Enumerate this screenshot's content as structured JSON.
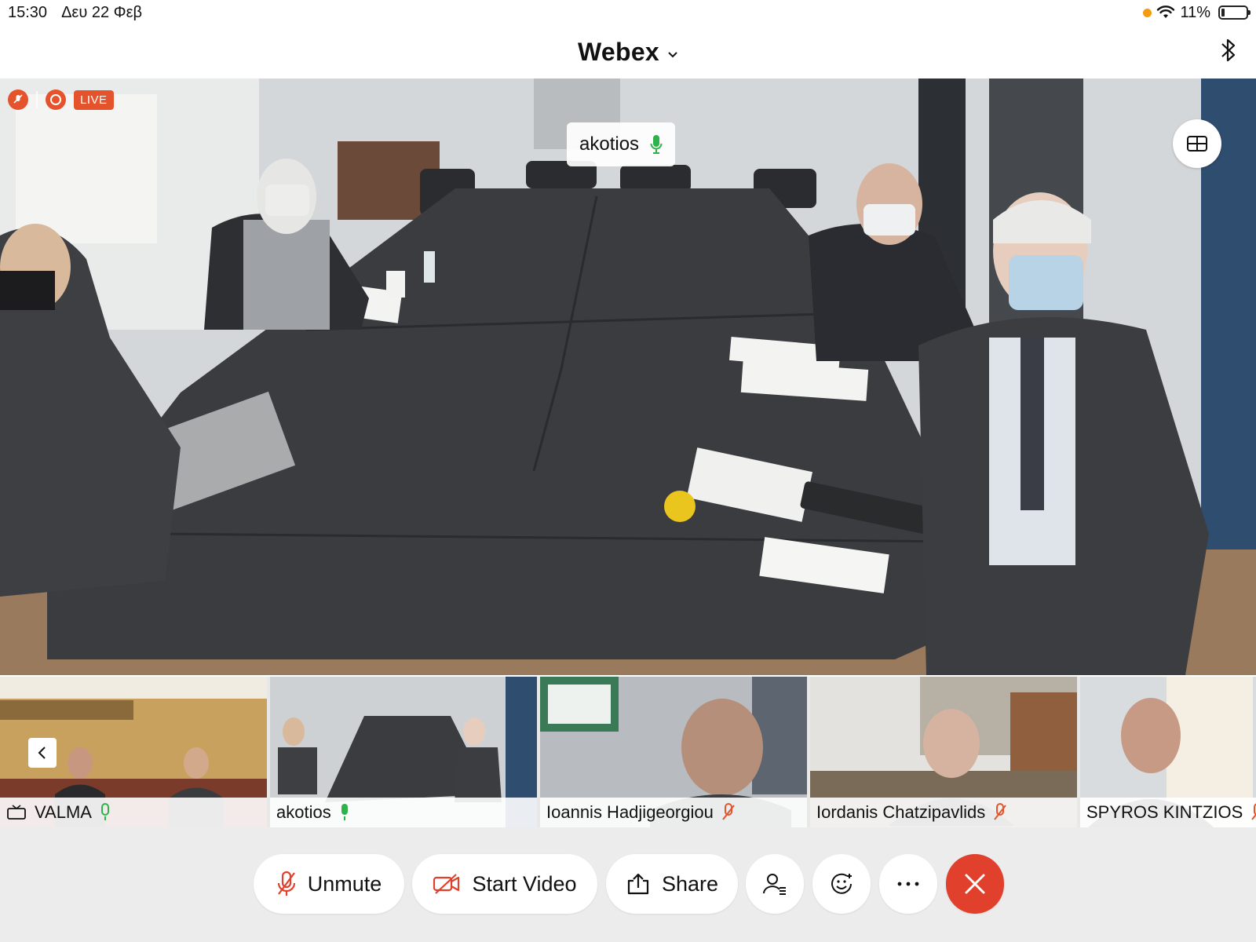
{
  "status_bar": {
    "time": "15:30",
    "date": "Δευ 22 Φεβ",
    "battery": "11%"
  },
  "title_bar": {
    "app_title": "Webex"
  },
  "main_video": {
    "live_label": "LIVE",
    "active_speaker": "akotios"
  },
  "participants": [
    {
      "name": "VALMA",
      "audio": "unmuted"
    },
    {
      "name": "akotios",
      "audio": "unmuted"
    },
    {
      "name": "Ioannis Hadjigeorgiou",
      "audio": "muted"
    },
    {
      "name": "Iordanis Chatzipavlids",
      "audio": "muted"
    },
    {
      "name": "SPYROS KINTZIOS",
      "audio": "muted"
    }
  ],
  "toolbar": {
    "unmute_label": "Unmute",
    "video_label": "Start Video",
    "share_label": "Share"
  },
  "colors": {
    "accent_red": "#e0402c",
    "mic_green": "#2db34a",
    "mute_red": "#e5532d"
  }
}
